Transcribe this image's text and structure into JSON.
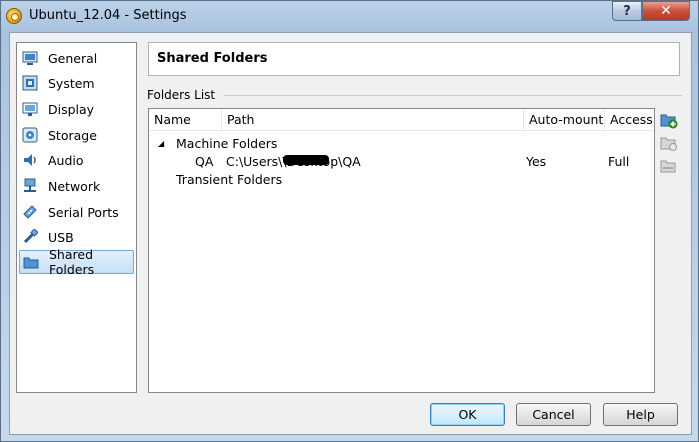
{
  "window": {
    "title": "Ubuntu_12.04 - Settings"
  },
  "titlebar": {
    "help_label": "?",
    "close_label": "✕"
  },
  "sidebar": {
    "items": [
      {
        "label": "General",
        "icon": "general-icon"
      },
      {
        "label": "System",
        "icon": "system-icon"
      },
      {
        "label": "Display",
        "icon": "display-icon"
      },
      {
        "label": "Storage",
        "icon": "storage-icon"
      },
      {
        "label": "Audio",
        "icon": "audio-icon"
      },
      {
        "label": "Network",
        "icon": "network-icon"
      },
      {
        "label": "Serial Ports",
        "icon": "serial-ports-icon"
      },
      {
        "label": "USB",
        "icon": "usb-icon"
      },
      {
        "label": "Shared Folders",
        "icon": "shared-folders-icon",
        "selected": true
      }
    ]
  },
  "panel": {
    "title": "Shared Folders",
    "group_label": "Folders List",
    "columns": [
      "Name",
      "Path",
      "Auto-mount",
      "Access"
    ],
    "tree": {
      "machine_folders": {
        "expander": "◢",
        "label": "Machine Folders",
        "rows": [
          {
            "name": "QA",
            "path_prefix": "C:\\Users\\",
            "path_suffix": "\\Desktop\\QA",
            "auto_mount": "Yes",
            "access": "Full"
          }
        ]
      },
      "transient_folders": {
        "label": "Transient Folders"
      }
    }
  },
  "buttons": {
    "ok": "OK",
    "cancel": "Cancel",
    "help": "Help"
  }
}
